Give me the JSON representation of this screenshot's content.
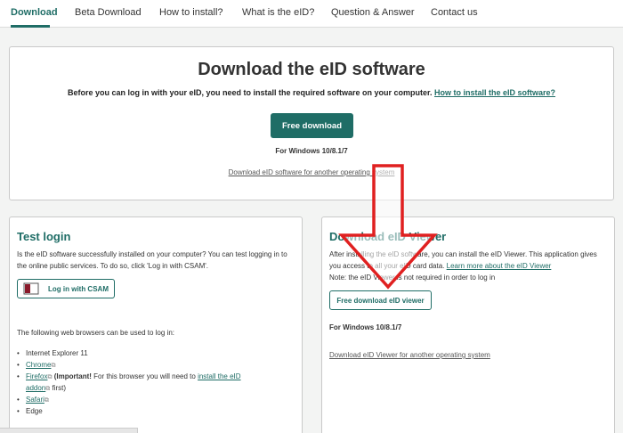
{
  "nav": {
    "tabs": [
      {
        "label": "Download"
      },
      {
        "label": "Beta Download"
      },
      {
        "label": "How to install?"
      },
      {
        "label": "What is the eID?"
      },
      {
        "label": "Question & Answer"
      },
      {
        "label": "Contact us"
      }
    ],
    "active_index": 0,
    "accent_color": "#1f6d66"
  },
  "hero": {
    "title": "Download the eID software",
    "subtitle": "Before you can log in with your eID, you need to install the required software on your computer.",
    "subtitle_link": "How to install the eID software?",
    "button_label": "Free download",
    "platform_note": "For Windows 10/8.1/7",
    "other_os_link": "Download eID software for another operating system"
  },
  "test_login": {
    "title": "Test login",
    "paragraph": "Is the eID software successfully installed on your computer? You can test logging in to the online public services. To do so, click 'Log in with CSAM'.",
    "button_label": "Log in with CSAM",
    "browsers_intro": "The following web browsers can be used to log in:",
    "browsers": [
      {
        "name": "Internet Explorer 11",
        "link": false
      },
      {
        "name": "Chrome",
        "link": true
      },
      {
        "name": "Firefox",
        "link": true,
        "note_bold": "(Important!",
        "note_rest": " For this browser you will need to ",
        "note_link": "install the eID addon",
        "note_end": " first)"
      },
      {
        "name": "Safari",
        "link": true
      },
      {
        "name": "Edge",
        "link": false
      }
    ]
  },
  "viewer": {
    "title": "Download eID Viewer",
    "paragraph": "After installing the eID software, you can install the eID Viewer. This application gives you access to all your eID card data.",
    "learn_more_link": "Learn more about the eID Viewer",
    "note": "Note: the eID Viewer is not required in order to log in",
    "button_label": "Free download eID viewer",
    "platform_note": "For Windows 10/8.1/7",
    "other_os_link": "Download eID Viewer for another operating system"
  },
  "annotation": {
    "type": "red-arrow-down",
    "color": "#e02020"
  }
}
